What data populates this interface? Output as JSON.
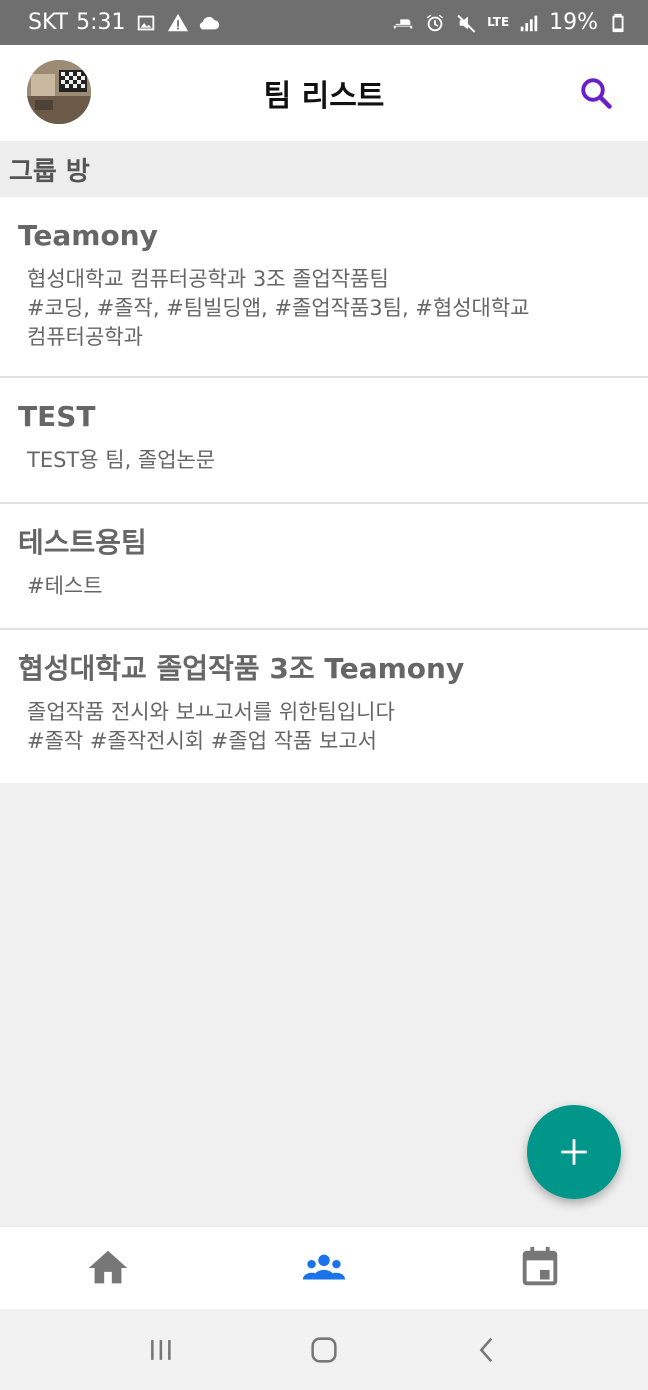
{
  "status_bar": {
    "carrier": "SKT",
    "time": "5:31",
    "lte": "LTE",
    "battery": "19%",
    "icons_left": [
      "image-icon",
      "warning-icon",
      "cloud-icon"
    ],
    "icons_right": [
      "bed-icon",
      "alarm-icon",
      "mute-icon",
      "lte-icon",
      "signal-icon",
      "battery-icon"
    ]
  },
  "app_bar": {
    "title": "팀 리스트",
    "search_icon": "search-icon",
    "accent_color": "#6a1fc7"
  },
  "section": {
    "title": "그룹 방"
  },
  "teams": [
    {
      "name": "Teamony",
      "description": "협성대학교 컴퓨터공학과 3조 졸업작품팀\n#코딩, #졸작, #팀빌딩앱, #졸업작품3팀, #협성대학교\n컴퓨터공학과"
    },
    {
      "name": "TEST",
      "description": "TEST용 팀, 졸업논문"
    },
    {
      "name": "테스트용팀",
      "description": "#테스트"
    },
    {
      "name": "협성대학교 졸업작품 3조 Teamony",
      "description": "졸업작품 전시와 보ㅛ고서를 위한팀입니다\n#졸작 #졸작전시회 #졸업 작품 보고서"
    }
  ],
  "fab": {
    "icon": "plus-icon",
    "color": "#00968a"
  },
  "bottom_nav": {
    "items": [
      {
        "icon": "home-icon",
        "active": false
      },
      {
        "icon": "group-icon",
        "active": true
      },
      {
        "icon": "calendar-icon",
        "active": false
      }
    ],
    "active_color": "#1a73e8",
    "inactive_color": "#777777"
  },
  "system_nav": {
    "items": [
      "recent-apps-icon",
      "home-circle-icon",
      "back-icon"
    ]
  }
}
